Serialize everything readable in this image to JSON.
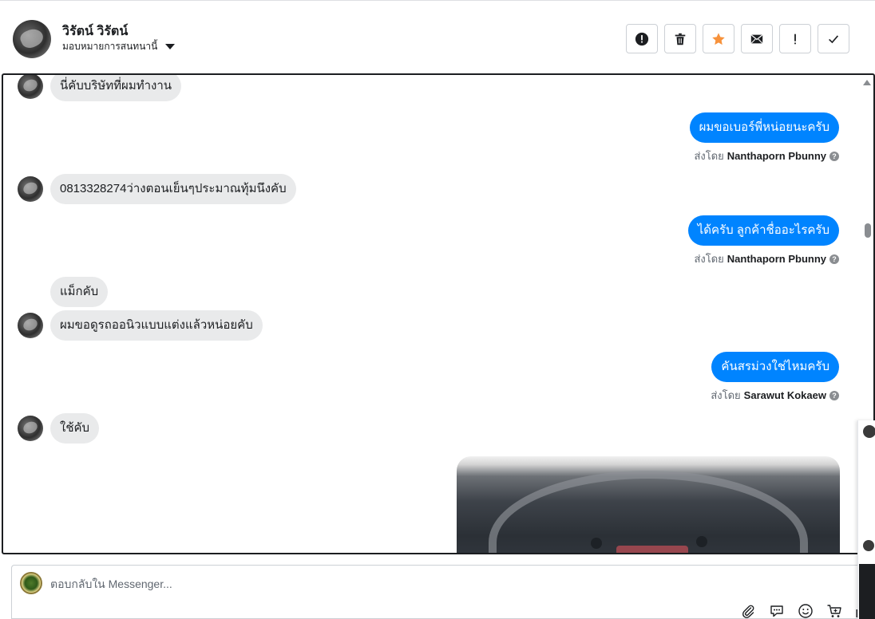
{
  "header": {
    "contact_name": "วิรัตน์ วิรัตน์",
    "assign_label": "มอบหมายการสนทนานี้",
    "toolbar": [
      {
        "name": "report-spam-button",
        "icon": "exclamation-circle-icon"
      },
      {
        "name": "delete-button",
        "icon": "trash-icon"
      },
      {
        "name": "star-button",
        "icon": "star-icon",
        "color": "#f7923b"
      },
      {
        "name": "mark-unread-button",
        "icon": "envelope-icon"
      },
      {
        "name": "follow-up-button",
        "icon": "exclamation-icon"
      },
      {
        "name": "mark-done-button",
        "icon": "checkmark-icon"
      }
    ]
  },
  "messages": {
    "m1": "นี่คับบริษัทที่ผมทำงาน",
    "m2": "ผมขอเบอร์พี่หน่อยนะครับ",
    "m3": "0813328274ว่างตอนเย็นๆประมาณทุ้มนึงคับ",
    "m4": "ได้ครับ ลูกค้าชื่ออะไรครับ",
    "m5": "แม็กคับ",
    "m6": "ผมขอดูรถออนิวแบบแต่งแล้วหน่อยคับ",
    "m7": "คันสรม่วงใช่ไหมครับ",
    "m8": "ใช้คับ"
  },
  "sent_by": {
    "prefix": "ส่งโดย",
    "s1": "Nanthaporn Pbunny",
    "s2": "Nanthaporn Pbunny",
    "s3": "Sarawut Kokaew"
  },
  "composer": {
    "placeholder": "ตอบกลับใน Messenger..."
  },
  "colors": {
    "outgoing_bubble": "#0084ff",
    "incoming_bubble": "#e9eaeb"
  }
}
